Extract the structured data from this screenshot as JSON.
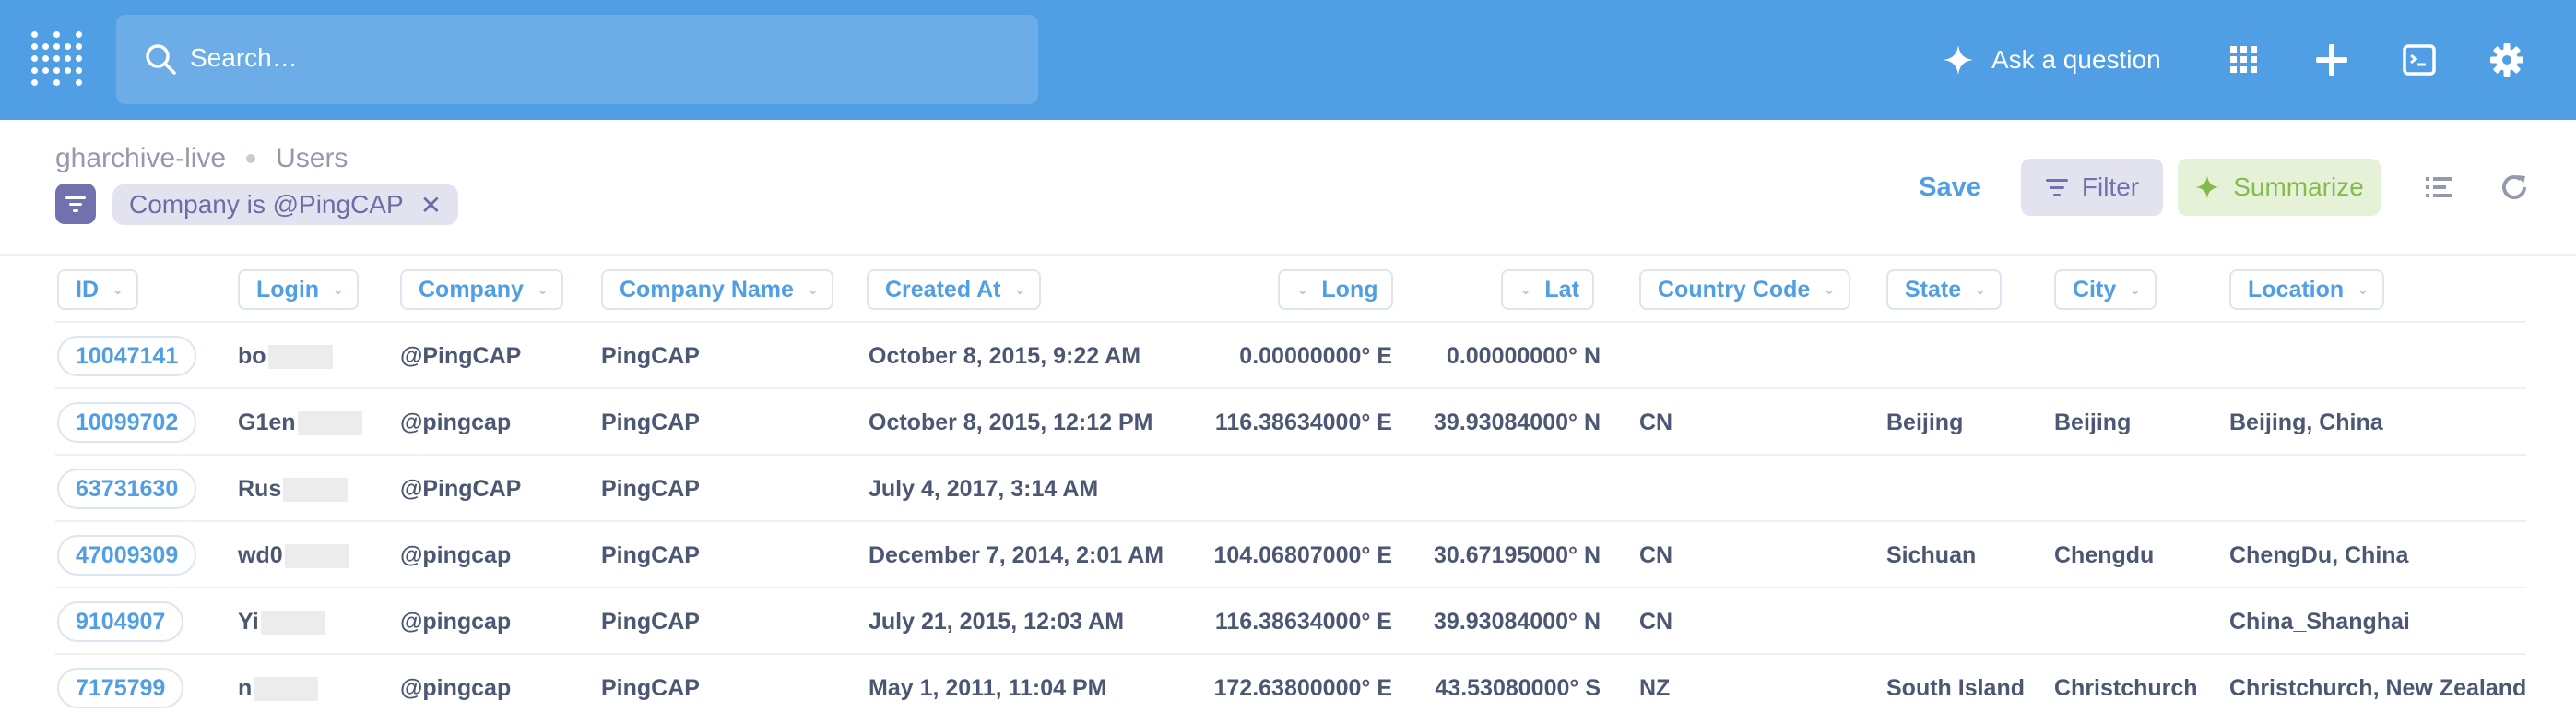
{
  "nav": {
    "search_placeholder": "Search…",
    "ask_label": "Ask a question",
    "icons": [
      "apps-grid-icon",
      "plus-icon",
      "terminal-icon",
      "gear-icon"
    ]
  },
  "header": {
    "database": "gharchive-live",
    "table": "Users",
    "filter_pill": "Company is @PingCAP",
    "save_label": "Save",
    "filter_label": "Filter",
    "summarize_label": "Summarize"
  },
  "colors": {
    "brand": "#509ee3",
    "filter": "#7172ad",
    "summarize": "#84bb4c"
  },
  "table": {
    "columns": [
      "ID",
      "Login",
      "Company",
      "Company Name",
      "Created At",
      "Long",
      "Lat",
      "Country Code",
      "State",
      "City",
      "Location"
    ],
    "rows": [
      {
        "id": "10047141",
        "login": "bo",
        "company": "@PingCAP",
        "company_name": "PingCAP",
        "created_at": "October 8, 2015, 9:22 AM",
        "long": "0.00000000° E",
        "lat": "0.00000000° N",
        "country": "",
        "state": "",
        "city": "",
        "location": ""
      },
      {
        "id": "10099702",
        "login": "G1en",
        "company": "@pingcap",
        "company_name": "PingCAP",
        "created_at": "October 8, 2015, 12:12 PM",
        "long": "116.38634000° E",
        "lat": "39.93084000° N",
        "country": "CN",
        "state": "Beijing",
        "city": "Beijing",
        "location": "Beijing, China"
      },
      {
        "id": "63731630",
        "login": "Rus",
        "company": "@PingCAP",
        "company_name": "PingCAP",
        "created_at": "July 4, 2017, 3:14 AM",
        "long": "",
        "lat": "",
        "country": "",
        "state": "",
        "city": "",
        "location": ""
      },
      {
        "id": "47009309",
        "login": "wd0",
        "company": "@pingcap",
        "company_name": "PingCAP",
        "created_at": "December 7, 2014, 2:01 AM",
        "long": "104.06807000° E",
        "lat": "30.67195000° N",
        "country": "CN",
        "state": "Sichuan",
        "city": "Chengdu",
        "location": "ChengDu, China"
      },
      {
        "id": "9104907",
        "login": "Yi",
        "company": "@pingcap",
        "company_name": "PingCAP",
        "created_at": "July 21, 2015, 12:03 AM",
        "long": "116.38634000° E",
        "lat": "39.93084000° N",
        "country": "CN",
        "state": "",
        "city": "",
        "location": "China_Shanghai"
      },
      {
        "id": "7175799",
        "login": "n",
        "company": "@pingcap",
        "company_name": "PingCAP",
        "created_at": "May 1, 2011, 11:04 PM",
        "long": "172.63800000° E",
        "lat": "43.53080000° S",
        "country": "NZ",
        "state": "South Island",
        "city": "Christchurch",
        "location": "Christchurch, New Zealand"
      }
    ]
  }
}
